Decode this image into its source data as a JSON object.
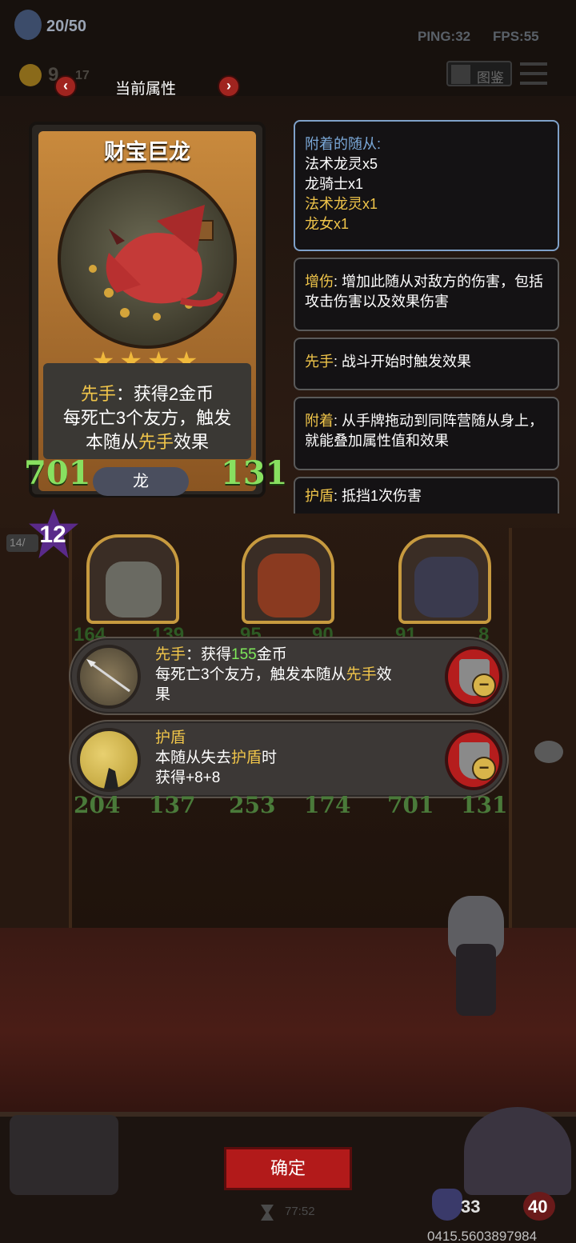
{
  "topbar": {
    "minion_count": "20/50",
    "gold": "9",
    "gold_income": "17",
    "ping": "PING:32",
    "fps": "FPS:55",
    "codex_label": "图鉴"
  },
  "attr_nav": {
    "label": "当前属性"
  },
  "card": {
    "name": "财宝巨龙",
    "stars": 4,
    "desc_line1_kw": "先手",
    "desc_line1_rest": "：获得2金币",
    "desc_line2": "每死亡3个友方，触发",
    "desc_line3_pre": "本随从",
    "desc_line3_kw": "先手",
    "desc_line3_post": "效果",
    "attack": "701",
    "health": "131",
    "tribe": "龙",
    "tier": "12",
    "tier_side": "14/"
  },
  "attached": {
    "title": "附着的随从:",
    "items": [
      {
        "text": "法术龙灵x5",
        "highlight": false
      },
      {
        "text": "龙骑士x1",
        "highlight": false
      },
      {
        "text": "法术龙灵x1",
        "highlight": true
      },
      {
        "text": "龙女x1",
        "highlight": true
      }
    ]
  },
  "keywords": [
    {
      "name": "增伤",
      "desc": "增加此随从对敌方的伤害，包括攻击伤害以及效果伤害"
    },
    {
      "name": "先手",
      "desc": "战斗开始时触发效果"
    },
    {
      "name": "附着",
      "desc": "从手牌拖动到同阵营随从身上，就能叠加属性值和效果"
    },
    {
      "name": "护盾",
      "desc": "抵挡1次伤害"
    }
  ],
  "effects": [
    {
      "kw": "先手",
      "line1_pre": "：获得",
      "line1_num": "155",
      "line1_post": "金币",
      "line2_pre": "每死亡3个友方，触发本随从",
      "line2_kw": "先手",
      "line2_post": "效",
      "line3": "果"
    },
    {
      "kw": "护盾",
      "line1_pre": "",
      "line1_num": "",
      "line1_post": "",
      "line2_pre": "本随从失去",
      "line2_kw": "护盾",
      "line2_post": "时",
      "line3": "获得+8+8"
    }
  ],
  "board": {
    "left_stats": [
      "204",
      "137"
    ],
    "mid_stats": [
      "253",
      "174"
    ],
    "right_stats": [
      "701",
      "131"
    ],
    "peek_stats": [
      "164",
      "139",
      "95",
      "90",
      "91",
      "8"
    ]
  },
  "bottom": {
    "confirm_label": "确定",
    "timer": "77:52",
    "player_armor": "33",
    "player_health": "40",
    "build_id": "0415.5603897984"
  }
}
